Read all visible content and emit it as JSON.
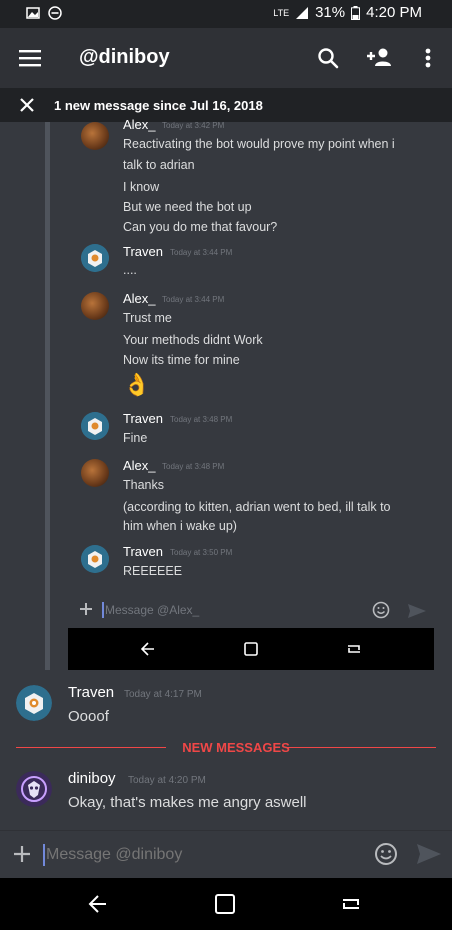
{
  "status_bar": {
    "network": "LTE",
    "battery": "31%",
    "clock": "4:20 PM"
  },
  "app_bar": {
    "title": "@diniboy"
  },
  "banner": {
    "text": "1 new message since Jul 16, 2018"
  },
  "embedded": {
    "messages": [
      {
        "author": "Alex_",
        "time": "Today at 3:42 PM",
        "lines": [
          "Reactivating the bot would prove my point when i",
          "talk to adrian",
          "I know",
          "But we need the bot up",
          "Can you do me that favour?"
        ]
      },
      {
        "author": "Traven",
        "time": "Today at 3:44 PM",
        "lines": [
          "...."
        ]
      },
      {
        "author": "Alex_",
        "time": "Today at 3:44 PM",
        "lines": [
          "Trust me",
          "Your methods didnt Work",
          "Now its time for mine"
        ],
        "emoji": "👌"
      },
      {
        "author": "Traven",
        "time": "Today at 3:48 PM",
        "lines": [
          "Fine"
        ]
      },
      {
        "author": "Alex_",
        "time": "Today at 3:48 PM",
        "lines": [
          "Thanks",
          "(according to kitten, adrian went to bed, ill talk to",
          "him when i wake up)"
        ]
      },
      {
        "author": "Traven",
        "time": "Today at 3:50 PM",
        "lines": [
          "REEEEEE"
        ]
      }
    ],
    "input_placeholder": "Message @Alex_"
  },
  "messages": [
    {
      "author": "Traven",
      "time": "Today at 4:17 PM",
      "text": "Oooof"
    },
    {
      "author": "diniboy",
      "time": "Today at 4:20 PM",
      "text": "Okay, that's makes me angry aswell"
    }
  ],
  "divider": {
    "label": "NEW MESSAGES"
  },
  "input": {
    "placeholder": "Message @diniboy"
  },
  "colors": {
    "background": "#36393f",
    "header": "#2f3136",
    "accent_red": "#f04747",
    "text": "#dcddde"
  }
}
